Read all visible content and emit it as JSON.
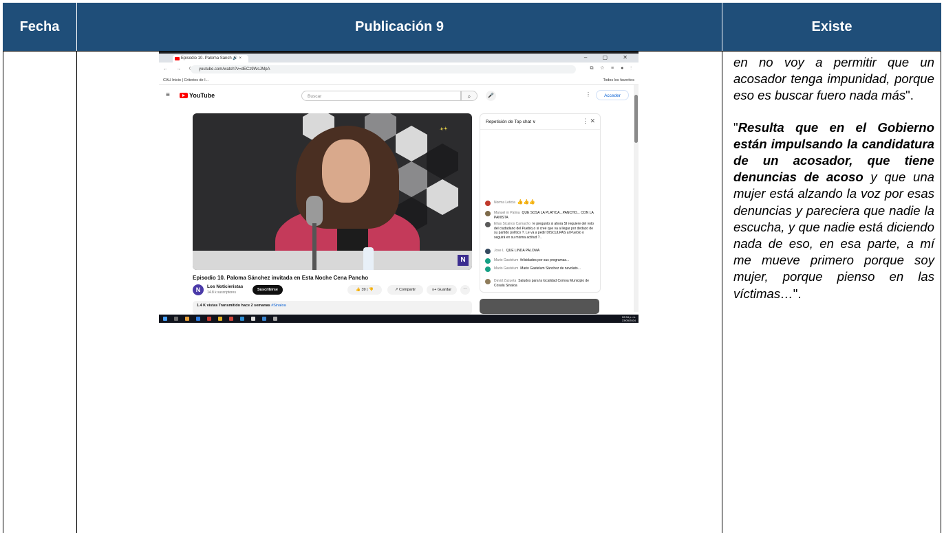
{
  "header": {
    "col1": "Fecha",
    "col2": "Publicación 9",
    "col3": "Existe"
  },
  "colors": {
    "header_bg": "#1f4e79",
    "header_text": "#ffffff"
  },
  "screenshot": {
    "tab_title": "Episodio 10. Paloma Sánch",
    "url": "youtube.com/watch?v=dECz9WsJMpA",
    "bookmark_left": "CAU   Inicio | Criterios de I...",
    "bookmark_right": "Todos los favoritos",
    "yt_logo": "YouTube",
    "search_placeholder": "Buscar",
    "signin": "Acceder",
    "chat_header": "Repetición de Top chat ∨",
    "chat": [
      {
        "name": "Norma Leticia",
        "text": "👍👍👍",
        "color": "#c0392b"
      },
      {
        "name": "Manuel m Palma",
        "text": "QUE SOSA LA PLATICA...PANCHO... CON LA PANISTA",
        "color": "#7d6a4a"
      },
      {
        "name": "Elías Sicairos Camacho",
        "text": "le pregunto si ahora SI requiere del voto del ciudadano del Pueblo,o si creé que va a llegar por dedazo de su partido político ?. Le va a pedir DISCULPAS al Pueblo o seguirá en su misma actitud ?..",
        "color": "#5a5a5a"
      },
      {
        "name": "Jose L",
        "text": "QUE LINDA PALOMA",
        "color": "#34495e"
      },
      {
        "name": "Mario Gastelum",
        "text": "felicidades por sus programas...",
        "color": "#16a085"
      },
      {
        "name": "Mario Gastelum",
        "text": "Mario Gastelum Sánchez de navolato...",
        "color": "#16a085"
      },
      {
        "name": "David Zazueta",
        "text": "Saludos para la localidad Comoa Municipio de Cosalá Sinaloa",
        "color": "#8e7b5a"
      }
    ],
    "video_title": "Episodio 10. Paloma Sánchez invitada en Esta Noche Cena Pancho",
    "channel": "Los Noticieristas",
    "subs": "14.8 k suscriptores",
    "subscribe": "Suscribirse",
    "likes": "39",
    "share": "Compartir",
    "save": "Guardar",
    "views": "1.4 K vistas  Transmitido hace 2 semanas",
    "hashtag": "#Sinaloa",
    "clock_time": "02:34 p. m.",
    "clock_date": "23/05/2024"
  },
  "existe": {
    "p1_italic": "en no voy a permitir que un acosador tenga impunidad, porque eso es buscar fuero nada más",
    "p1_end": "\".",
    "p2_open": "\"",
    "p2_bold": "Resulta que en el Gobierno están impulsando la candidatura de un acosador, que tiene denuncias de acoso",
    "p2_italic": " y que una mujer está alzando la voz por esas denuncias y pareciera que nadie la escucha, y que nadie está diciendo nada de eso, en esa parte, a mí me mueve primero porque soy mujer, porque pienso en las víctimas…",
    "p2_end": "\"."
  }
}
